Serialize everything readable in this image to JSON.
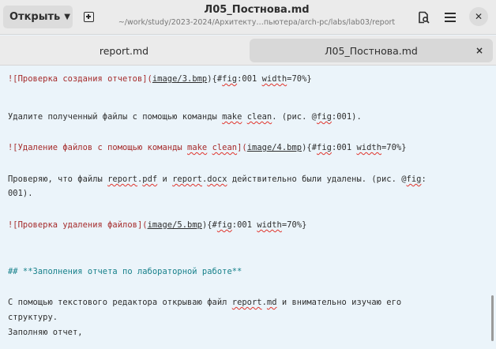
{
  "header": {
    "open_label": "Открыть",
    "title": "Л05_Постнова.md",
    "subtitle": "~/work/study/2023-2024/Архитекту…пьютера/arch-pc/labs/lab03/report"
  },
  "tabs": [
    {
      "label": "report.md"
    },
    {
      "label": "Л05_Постнова.md",
      "close": "×"
    }
  ],
  "editor": {
    "l1": {
      "a": "![Проверка создания отчетов](",
      "b": "image/3.bmp",
      "c": "){#",
      "d": "fig",
      "e": ":001 ",
      "f": "width",
      "g": "=70%}"
    },
    "l2": {
      "a": "Удалите полученный файлы с помощью команды ",
      "b": "make",
      "c": " ",
      "d": "clean",
      "e": ". (рис. @",
      "f": "fig",
      "g": ":001)."
    },
    "l3": {
      "a": "![Удаление файлов с помощью команды ",
      "b": "make",
      "c": " ",
      "d": "clean",
      "e": "](",
      "f": "image/4.bmp",
      "g": "){#",
      "h": "fig",
      "i": ":001 ",
      "j": "width",
      "k": "=70%}"
    },
    "l4": {
      "a": "Проверяю, что файлы ",
      "b": "report",
      "c": ".",
      "d": "pdf",
      "e": " и ",
      "f": "report",
      "g": ".",
      "h": "docx",
      "i": " действительно были удалены. (рис. @",
      "j": "fig",
      "k": ":"
    },
    "l5": {
      "a": "001)."
    },
    "l6": {
      "a": "![Проверка удаления файлов](",
      "b": "image/5.bmp",
      "c": "){#",
      "d": "fig",
      "e": ":001 ",
      "f": "width",
      "g": "=70%}"
    },
    "l7": {
      "a": "## **Заполнения отчета по лабораторной работе**"
    },
    "l8": {
      "a": "С помощью текстового редактора открываю файл ",
      "b": "report",
      "c": ".",
      "d": "md",
      "e": " и внимательно изучаю его"
    },
    "l9": {
      "a": "структуру."
    },
    "l10": {
      "a": "Заполняю отчет,"
    }
  }
}
